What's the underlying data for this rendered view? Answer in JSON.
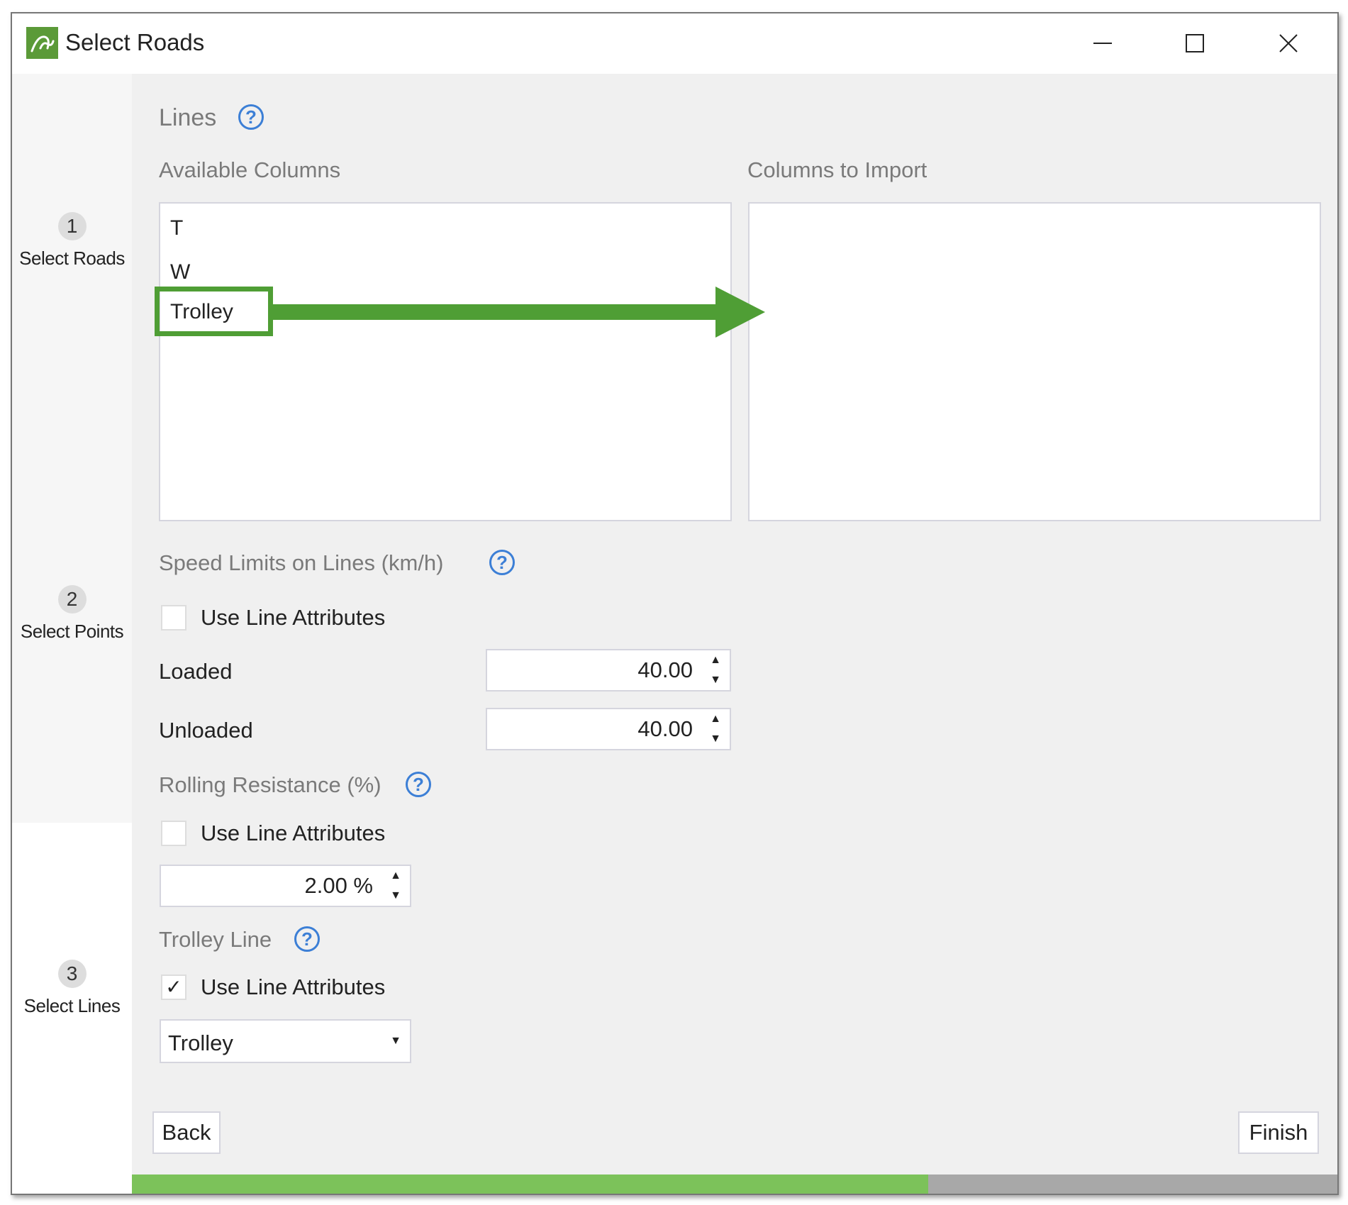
{
  "window": {
    "title": "Select Roads",
    "app_icon": "road-logo-icon"
  },
  "steps": [
    {
      "number": "1",
      "label": "Select Roads"
    },
    {
      "number": "2",
      "label": "Select Points"
    },
    {
      "number": "3",
      "label": "Select Lines"
    }
  ],
  "lines": {
    "heading": "Lines",
    "available_label": "Available Columns",
    "import_label": "Columns to Import",
    "available_items": [
      "T",
      "W",
      "Trolley"
    ],
    "import_items": []
  },
  "speed": {
    "heading": "Speed Limits on Lines (km/h)",
    "use_attributes_label": "Use Line Attributes",
    "use_attributes_checked": false,
    "loaded_label": "Loaded",
    "loaded_value": "40.00",
    "unloaded_label": "Unloaded",
    "unloaded_value": "40.00"
  },
  "rolling": {
    "heading": "Rolling Resistance (%)",
    "use_attributes_label": "Use Line Attributes",
    "use_attributes_checked": false,
    "value": "2.00 %"
  },
  "trolley": {
    "heading": "Trolley Line",
    "use_attributes_label": "Use Line Attributes",
    "use_attributes_checked": true,
    "selected": "Trolley"
  },
  "buttons": {
    "back": "Back",
    "finish": "Finish"
  },
  "progress": {
    "percent": 66
  },
  "colors": {
    "accent": "#5b9a38",
    "annotation": "#4f9e35",
    "progress": "#7cc25a",
    "help": "#3c7fd6"
  },
  "symbols": {
    "help": "?",
    "check": "✓",
    "up": "▲",
    "down": "▼"
  }
}
